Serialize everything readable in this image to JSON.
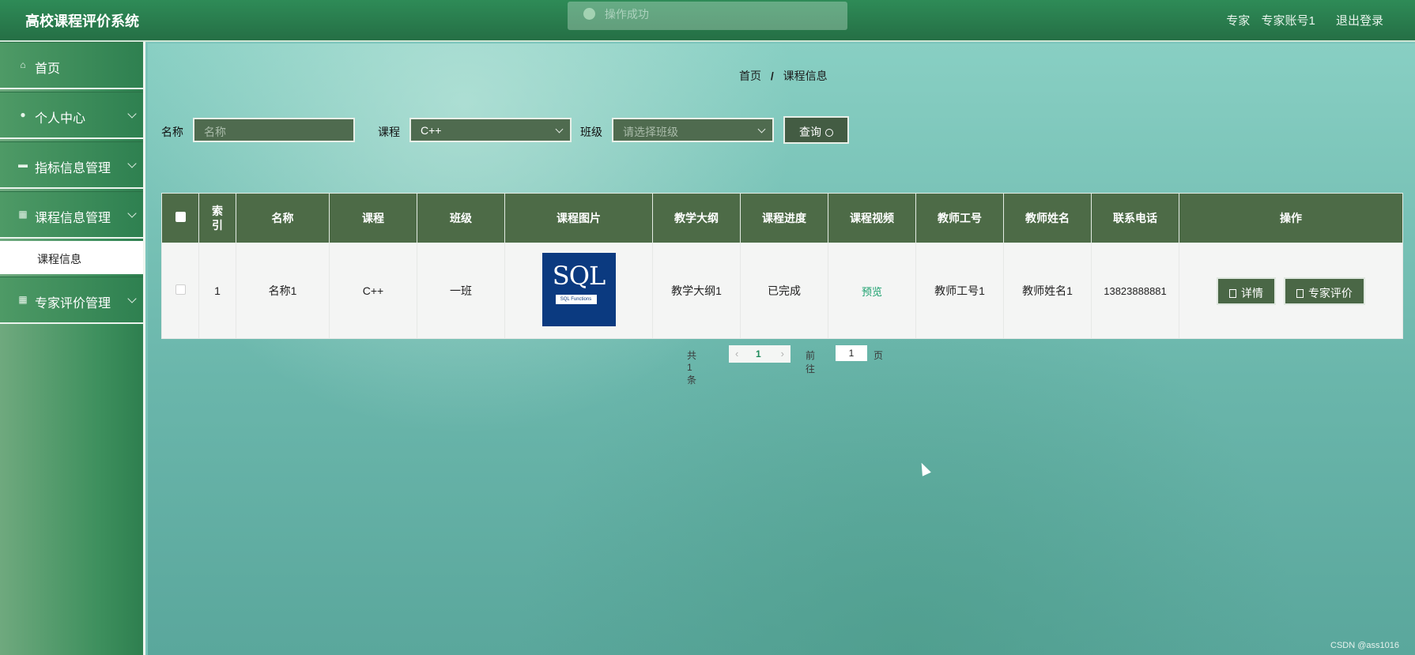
{
  "header": {
    "title": "高校课程评价系统",
    "role": "专家",
    "account": "专家账号1",
    "logout": "退出登录",
    "toast": "操作成功"
  },
  "sidebar": {
    "items": [
      {
        "label": "首页",
        "icon": "home-icon"
      },
      {
        "label": "个人中心",
        "icon": "user-icon"
      },
      {
        "label": "指标信息管理",
        "icon": "chat-icon"
      },
      {
        "label": "课程信息管理",
        "icon": "grid-icon"
      },
      {
        "label": "专家评价管理",
        "icon": "grid-icon"
      }
    ],
    "submenu": {
      "label": "课程信息"
    }
  },
  "breadcrumb": {
    "home": "首页",
    "sep": "/",
    "current": "课程信息"
  },
  "search": {
    "name_label": "名称",
    "name_placeholder": "名称",
    "course_label": "课程",
    "course_value": "C++",
    "class_label": "班级",
    "class_placeholder": "请选择班级",
    "query_button": "查询"
  },
  "table": {
    "headers": [
      "索引",
      "名称",
      "课程",
      "班级",
      "课程图片",
      "教学大纲",
      "课程进度",
      "课程视频",
      "教师工号",
      "教师姓名",
      "联系电话",
      "操作"
    ],
    "rows": [
      {
        "index": "1",
        "name": "名称1",
        "course": "C++",
        "class": "一班",
        "image_text": "SQL",
        "image_sub": "SQL Functions",
        "syllabus": "教学大纲1",
        "progress": "已完成",
        "video": "预览",
        "teacher_id": "教师工号1",
        "teacher_name": "教师姓名1",
        "phone": "13823888881",
        "detail_button": "详情",
        "evaluate_button": "专家评价"
      }
    ]
  },
  "pagination": {
    "total_prefix": "共",
    "total": "1",
    "total_suffix": "条",
    "current_page": "1",
    "goto": "前往",
    "goto_value": "1",
    "unit": "页"
  },
  "watermark": "CSDN @ass1016"
}
